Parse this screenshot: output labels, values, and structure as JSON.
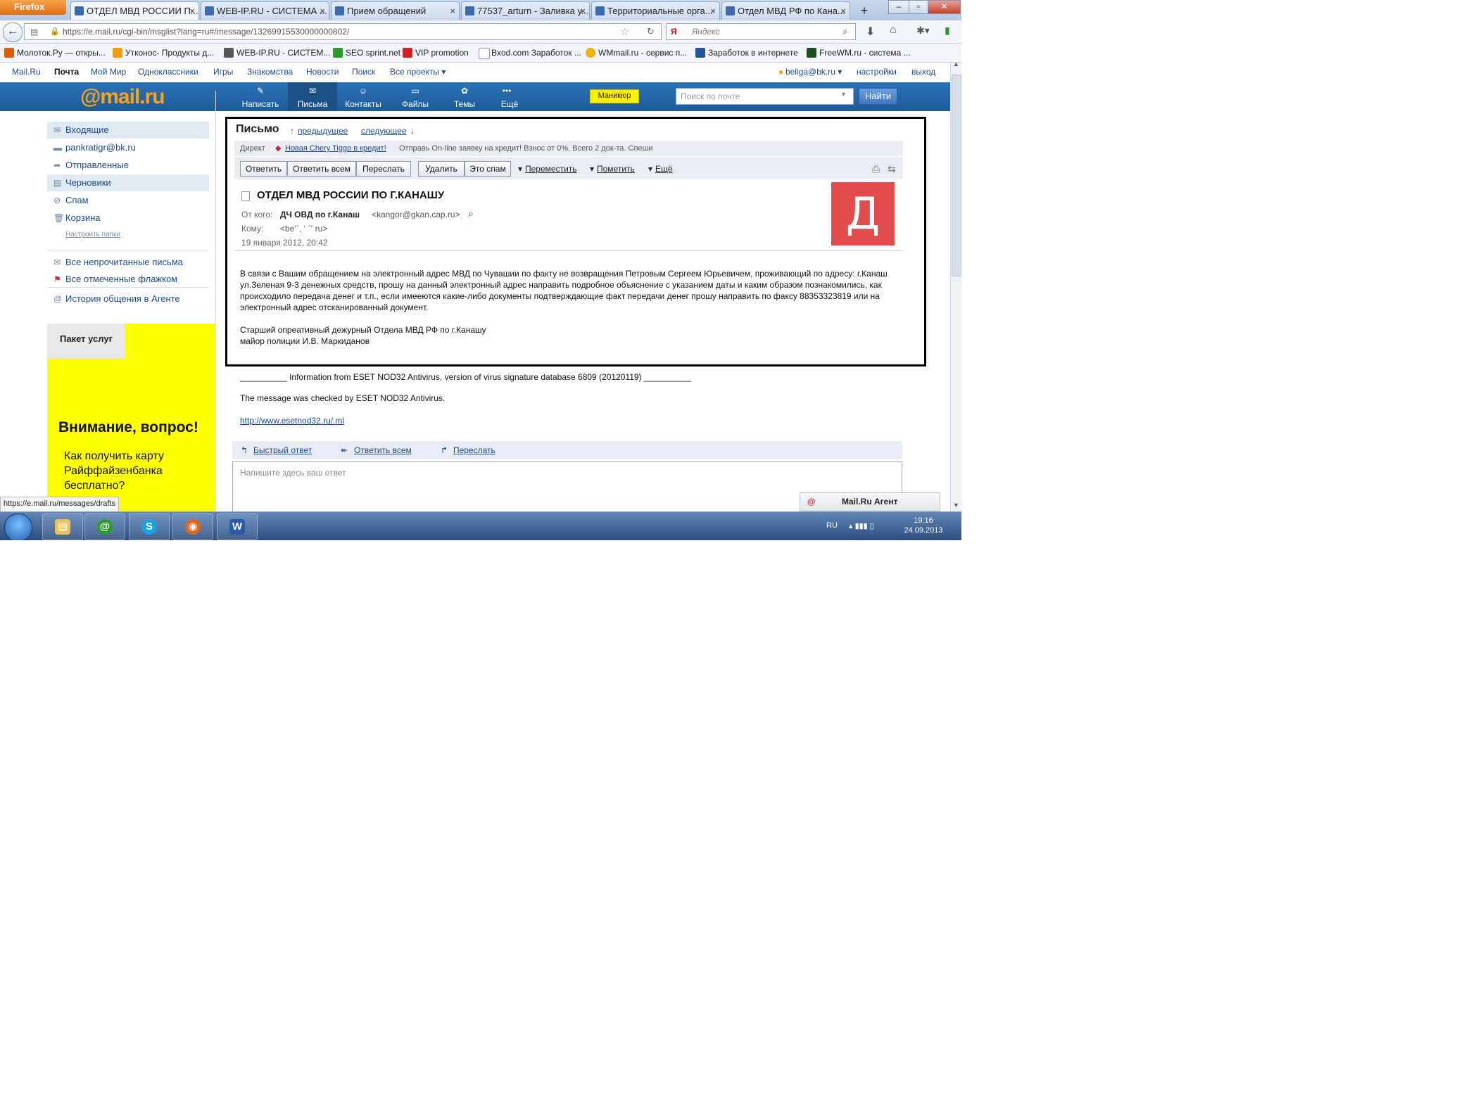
{
  "browser": {
    "menu_button": "Firefox",
    "tabs": [
      {
        "label": "ОТДЕЛ МВД РОССИИ П...",
        "active": true
      },
      {
        "label": "WEB-IP.RU - СИСТЕМА ...",
        "active": false
      },
      {
        "label": "Прием обращений",
        "active": false
      },
      {
        "label": "77537_arturn - Заливка у...",
        "active": false
      },
      {
        "label": "Территориальные орга...",
        "active": false
      },
      {
        "label": "Отдел МВД РФ по Кана...",
        "active": false
      }
    ],
    "new_tab": "+",
    "url": "https://e.mail.ru/cgi-bin/msglist?lang=ru#/message/13269915530000000802/",
    "search_placeholder": "Яндекс",
    "bookmarks": [
      {
        "label": "Молоток.Ру — откры...",
        "color": "#e05a00"
      },
      {
        "label": "Утконос- Продукты д...",
        "color": "#f0a000"
      },
      {
        "label": "WEB-IP.RU - СИСТЕМ...",
        "color": "#555555"
      },
      {
        "label": "SEO sprint.net",
        "color": "#2a9a2a"
      },
      {
        "label": "VIP promotion",
        "color": "#d02020"
      },
      {
        "label": "Bxod.com Заработок ...",
        "color": "#cccccc"
      },
      {
        "label": "WMmail.ru - сервис п...",
        "color": "#f0b000"
      },
      {
        "label": "Заработок в интернете",
        "color": "#2050a0"
      },
      {
        "label": "FreeWM.ru - система ...",
        "color": "#205020"
      }
    ],
    "status_link": "https://e.mail.ru/messages/drafts"
  },
  "mailru": {
    "top_links": [
      "Mail.Ru",
      "Почта",
      "Мой Мир",
      "Одноклассники",
      "Игры",
      "Знакомства",
      "Новости",
      "Поиск",
      "Все проекты ▾"
    ],
    "user": "beliga@bk.ru ▾",
    "settings": "настройки",
    "logout": "выход",
    "logo": "@mail.ru",
    "nav_tabs": [
      {
        "label": "Написать",
        "icon": "✎"
      },
      {
        "label": "Письма",
        "icon": "✉"
      },
      {
        "label": "Контакты",
        "icon": "☺"
      },
      {
        "label": "Файлы",
        "icon": "▭"
      },
      {
        "label": "Темы",
        "icon": "✿"
      },
      {
        "label": "Ещё",
        "icon": "•••"
      }
    ],
    "promo_badge": "Маникюр",
    "search_placeholder": "Поиск по почте",
    "search_button": "Найти"
  },
  "sidebar": {
    "folders": [
      {
        "label": "Входящие",
        "icon": "✉"
      },
      {
        "label": "pankratigr@bk.ru",
        "icon": "▬"
      },
      {
        "label": "Отправленные",
        "icon": "➦"
      },
      {
        "label": "Черновики",
        "icon": "▤"
      },
      {
        "label": "Спам",
        "icon": "⊘"
      },
      {
        "label": "Корзина",
        "icon": "🗑"
      }
    ],
    "configure_folders": "Настроить папки",
    "extra": [
      {
        "label": "Все непрочитанные письма",
        "icon": "✉"
      },
      {
        "label": "Все отмеченные флажком",
        "icon": "⚑"
      }
    ],
    "agent_history": "История общения в Агенте",
    "ad": {
      "corner_title": "Пакет услуг",
      "headline": "Внимание, вопрос!",
      "body": "Как получить карту Райффайзенбанка бесплатно?"
    }
  },
  "message": {
    "section_title": "Письмо",
    "prev": "предыдущее",
    "next": "следующее",
    "direct_label": "Директ",
    "direct_link": "Новая Chery Tiggo в кредит!",
    "direct_text": "Отправь On-line заявку на кредит! Взнос от 0%. Всего 2 док-та. Спеши",
    "buttons": {
      "reply": "Ответить",
      "reply_all": "Ответить всем",
      "forward": "Переслать",
      "delete": "Удалить",
      "spam": "Это спам",
      "move": "Переместить",
      "mark": "Пометить",
      "more": "Ещё"
    },
    "subject": "ОТДЕЛ МВД РОССИИ ПО Г.КАНАШУ",
    "from_label": "От кого:",
    "from_name": "ДЧ ОВД по г.Канаш",
    "from_email": "<kangor@gkan.cap.ru>",
    "to_label": "Кому:",
    "to_value": "<be‘`,  ‘ `‘  ru>",
    "date": "19 января 2012, 20:42",
    "avatar_letter": "Д",
    "avatar_color": "#e04b4b",
    "body": "В связи с Вашим обращением на электронный адрес МВД по Чувашии по факту не возвращения Петровым Сергеем Юрьевичем, проживающий по адресу: г.Канаш ул.Зеленая 9-3 денежных средств, прошу на данный электронный адрес направить подробное объяснение  с указанием даты и каким образом познакомились, как происходило передача денег и т.п., если имееются какие-либо документы подтверждающие факт передачи денег прошу направить по факсу 88353323819 или на электронный адрес отсканированный документ.\n\nСтарший опреативный дежурный Отдела МВД РФ по г.Канашу\nмайор полиции                                               И.В. Маркиданов"
  },
  "footer": {
    "eset_line": "__________ Information from ESET NOD32 Antivirus, version of virus signature database 6809 (20120119) __________",
    "checked_line": "The message was checked by ESET NOD32 Antivirus.",
    "eset_link": "http://www.esetnod32.ru/.ml",
    "quick_reply": "Быстрый ответ",
    "reply_all": "Ответить всем",
    "forward": "Переслать",
    "reply_placeholder": "Напишите здесь ваш ответ",
    "agent_title": "Mail.Ru Агент"
  },
  "taskbar": {
    "lang": "RU",
    "time": "19:16",
    "date": "24.09.2013",
    "apps": [
      {
        "name": "explorer",
        "icon": "▤",
        "color": "#e8c45a"
      },
      {
        "name": "mail-agent",
        "icon": "@",
        "color": "#2a9a2a"
      },
      {
        "name": "skype",
        "icon": "S",
        "color": "#1aa1e1"
      },
      {
        "name": "firefox",
        "icon": "◉",
        "color": "#e0661a"
      },
      {
        "name": "word",
        "icon": "W",
        "color": "#2b5aa8"
      }
    ]
  }
}
